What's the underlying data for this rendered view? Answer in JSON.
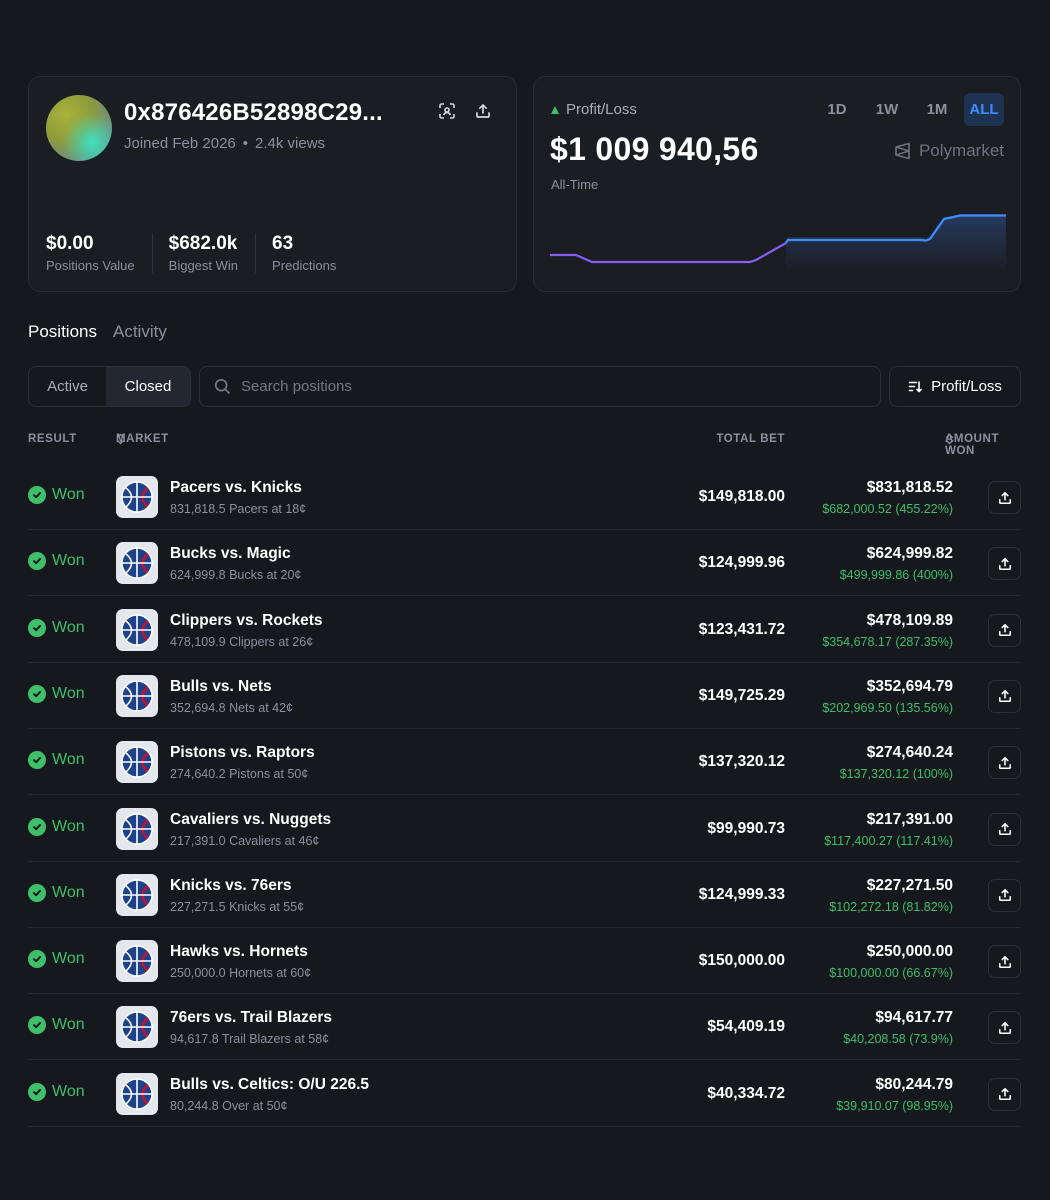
{
  "profile": {
    "wallet_name": "0x876426B52898C29...",
    "joined": "Joined Feb 2026",
    "views": "2.4k views",
    "stats": [
      {
        "value": "$0.00",
        "label": "Positions Value"
      },
      {
        "value": "$682.0k",
        "label": "Biggest Win"
      },
      {
        "value": "63",
        "label": "Predictions"
      }
    ]
  },
  "pnl": {
    "label": "Profit/Loss",
    "value": "$1 009 940,56",
    "period": "All-Time",
    "ranges": [
      "1D",
      "1W",
      "1M",
      "ALL"
    ],
    "active_range": "ALL",
    "brand": "Polymarket",
    "colors": {
      "negative_line": "#8b5cf6",
      "positive_line": "#3d8eff",
      "up_indicator": "#3fbf6a"
    }
  },
  "tabs": {
    "positions": "Positions",
    "activity": "Activity",
    "active": "Positions"
  },
  "filters": {
    "active_label": "Active",
    "closed_label": "Closed",
    "selected": "Closed",
    "search_placeholder": "Search positions",
    "sort_label": "Profit/Loss"
  },
  "table": {
    "headers": {
      "result": "RESULT",
      "market": "MARKET",
      "total_bet": "TOTAL BET",
      "amount_won": "AMOUNT WON"
    },
    "rows": [
      {
        "result": "Won",
        "title": "Pacers vs. Knicks",
        "sub": "831,818.5 Pacers at 18¢",
        "total_bet": "$149,818.00",
        "amount_won": "$831,818.52",
        "gain": "$682,000.52 (455.22%)"
      },
      {
        "result": "Won",
        "title": "Bucks vs. Magic",
        "sub": "624,999.8 Bucks at 20¢",
        "total_bet": "$124,999.96",
        "amount_won": "$624,999.82",
        "gain": "$499,999.86 (400%)"
      },
      {
        "result": "Won",
        "title": "Clippers vs. Rockets",
        "sub": "478,109.9 Clippers at 26¢",
        "total_bet": "$123,431.72",
        "amount_won": "$478,109.89",
        "gain": "$354,678.17 (287.35%)"
      },
      {
        "result": "Won",
        "title": "Bulls vs. Nets",
        "sub": "352,694.8 Nets at 42¢",
        "total_bet": "$149,725.29",
        "amount_won": "$352,694.79",
        "gain": "$202,969.50 (135.56%)"
      },
      {
        "result": "Won",
        "title": "Pistons vs. Raptors",
        "sub": "274,640.2 Pistons at 50¢",
        "total_bet": "$137,320.12",
        "amount_won": "$274,640.24",
        "gain": "$137,320.12 (100%)"
      },
      {
        "result": "Won",
        "title": "Cavaliers vs. Nuggets",
        "sub": "217,391.0 Cavaliers at 46¢",
        "total_bet": "$99,990.73",
        "amount_won": "$217,391.00",
        "gain": "$117,400.27 (117.41%)"
      },
      {
        "result": "Won",
        "title": "Knicks vs. 76ers",
        "sub": "227,271.5 Knicks at 55¢",
        "total_bet": "$124,999.33",
        "amount_won": "$227,271.50",
        "gain": "$102,272.18 (81.82%)"
      },
      {
        "result": "Won",
        "title": "Hawks vs. Hornets",
        "sub": "250,000.0 Hornets at 60¢",
        "total_bet": "$150,000.00",
        "amount_won": "$250,000.00",
        "gain": "$100,000.00 (66.67%)"
      },
      {
        "result": "Won",
        "title": "76ers vs. Trail Blazers",
        "sub": "94,617.8 Trail Blazers at 58¢",
        "total_bet": "$54,409.19",
        "amount_won": "$94,617.77",
        "gain": "$40,208.58 (73.9%)"
      },
      {
        "result": "Won",
        "title": "Bulls vs. Celtics: O/U 226.5",
        "sub": "80,244.8 Over at 50¢",
        "total_bet": "$40,334.72",
        "amount_won": "$80,244.79",
        "gain": "$39,910.07 (98.95%)"
      }
    ]
  }
}
